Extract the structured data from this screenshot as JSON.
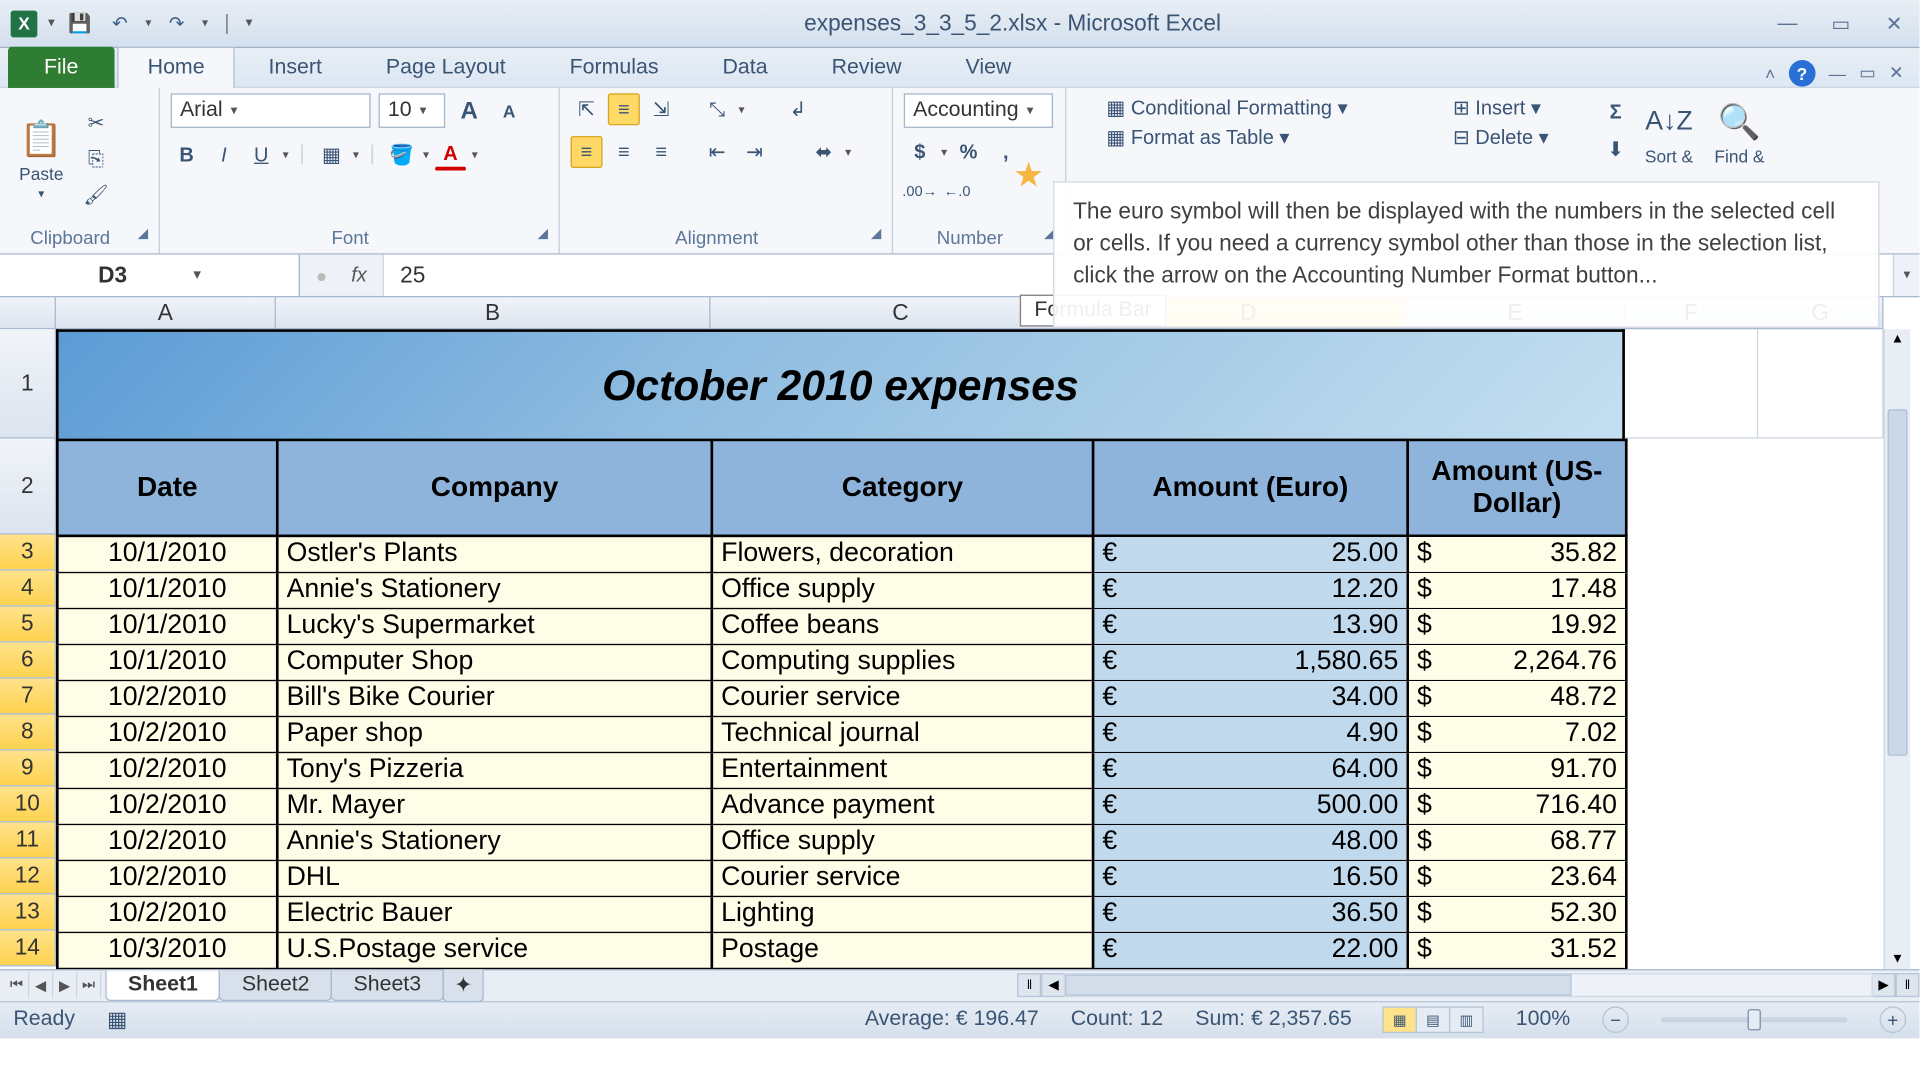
{
  "window": {
    "title": "expenses_3_3_5_2.xlsx - Microsoft Excel"
  },
  "tabs": [
    "File",
    "Home",
    "Insert",
    "Page Layout",
    "Formulas",
    "Data",
    "Review",
    "View"
  ],
  "active_tab": "Home",
  "groups": {
    "clipboard": {
      "label": "Clipboard",
      "paste": "Paste"
    },
    "font": {
      "label": "Font",
      "name": "Arial",
      "size": "10"
    },
    "alignment": {
      "label": "Alignment"
    },
    "number": {
      "label": "Number",
      "format": "Accounting"
    },
    "styles": {
      "cond": "Conditional Formatting",
      "table": "Format as Table"
    },
    "cells": {
      "insert": "Insert",
      "delete": "Delete"
    },
    "editing": {
      "sort": "Sort &",
      "find": "Find &"
    }
  },
  "tooltip": "The euro symbol will then be displayed with the numbers in the selected cell or cells. If you need a currency symbol other than those in the selection list, click the arrow on the Accounting Number Format button...",
  "formula_bar": {
    "name_box": "D3",
    "formula": "25",
    "tip": "Formula Bar"
  },
  "columns": [
    "A",
    "B",
    "C",
    "D",
    "E",
    "F",
    "G"
  ],
  "selected_col": "D",
  "title_cell": "October 2010 expenses",
  "headers": [
    "Date",
    "Company",
    "Category",
    "Amount (Euro)",
    "Amount (US-Dollar)"
  ],
  "rows": [
    {
      "n": 3,
      "date": "10/1/2010",
      "company": "Ostler's Plants",
      "category": "Flowers, decoration",
      "euro": "25.00",
      "usd": "35.82"
    },
    {
      "n": 4,
      "date": "10/1/2010",
      "company": "Annie's Stationery",
      "category": "Office supply",
      "euro": "12.20",
      "usd": "17.48"
    },
    {
      "n": 5,
      "date": "10/1/2010",
      "company": "Lucky's Supermarket",
      "category": "Coffee beans",
      "euro": "13.90",
      "usd": "19.92"
    },
    {
      "n": 6,
      "date": "10/1/2010",
      "company": "Computer Shop",
      "category": "Computing supplies",
      "euro": "1,580.65",
      "usd": "2,264.76"
    },
    {
      "n": 7,
      "date": "10/2/2010",
      "company": "Bill's Bike Courier",
      "category": "Courier service",
      "euro": "34.00",
      "usd": "48.72"
    },
    {
      "n": 8,
      "date": "10/2/2010",
      "company": "Paper shop",
      "category": "Technical journal",
      "euro": "4.90",
      "usd": "7.02"
    },
    {
      "n": 9,
      "date": "10/2/2010",
      "company": "Tony's Pizzeria",
      "category": "Entertainment",
      "euro": "64.00",
      "usd": "91.70"
    },
    {
      "n": 10,
      "date": "10/2/2010",
      "company": "Mr. Mayer",
      "category": "Advance payment",
      "euro": "500.00",
      "usd": "716.40"
    },
    {
      "n": 11,
      "date": "10/2/2010",
      "company": "Annie's Stationery",
      "category": "Office supply",
      "euro": "48.00",
      "usd": "68.77"
    },
    {
      "n": 12,
      "date": "10/2/2010",
      "company": "DHL",
      "category": "Courier service",
      "euro": "16.50",
      "usd": "23.64"
    },
    {
      "n": 13,
      "date": "10/2/2010",
      "company": "Electric Bauer",
      "category": "Lighting",
      "euro": "36.50",
      "usd": "52.30"
    },
    {
      "n": 14,
      "date": "10/3/2010",
      "company": "U.S.Postage service",
      "category": "Postage",
      "euro": "22.00",
      "usd": "31.52"
    }
  ],
  "row1_h": 82,
  "row2_h": 72,
  "sheets": [
    "Sheet1",
    "Sheet2",
    "Sheet3"
  ],
  "active_sheet": "Sheet1",
  "status": {
    "ready": "Ready",
    "average": "Average:  € 196.47",
    "count": "Count: 12",
    "sum": "Sum:  € 2,357.65",
    "zoom": "100%"
  }
}
